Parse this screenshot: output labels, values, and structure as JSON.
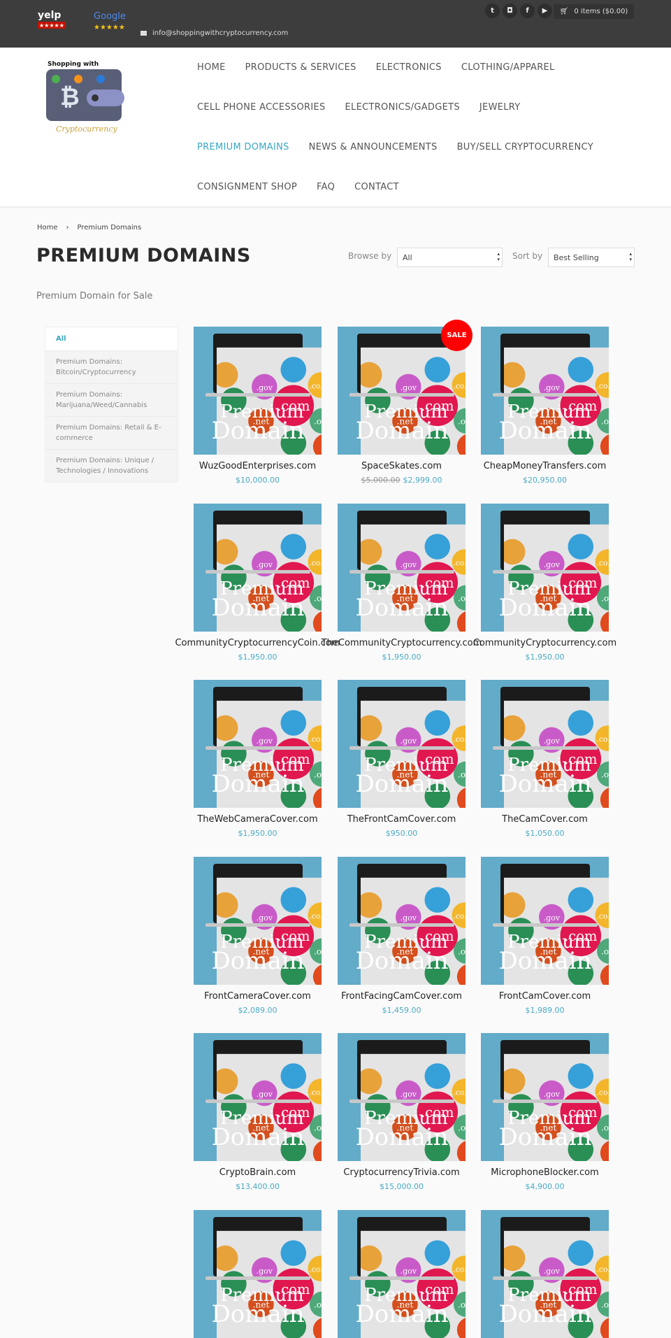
{
  "topbar": {
    "email": "info@shoppingwithcryptocurrency.com",
    "social": [
      "twitter",
      "instagram",
      "facebook",
      "youtube"
    ],
    "cart": "0 items ($0.00)",
    "yelp_logo": "yelp",
    "google_logo": "Google"
  },
  "logo": {
    "top": "Shopping with",
    "bottom": "Cryptocurrency"
  },
  "nav": [
    {
      "label": "HOME"
    },
    {
      "label": "PRODUCTS & SERVICES"
    },
    {
      "label": "ELECTRONICS"
    },
    {
      "label": "CLOTHING/APPAREL"
    },
    {
      "label": "CELL PHONE ACCESSORIES"
    },
    {
      "label": "ELECTRONICS/GADGETS"
    },
    {
      "label": "JEWELRY"
    },
    {
      "label": "PREMIUM DOMAINS",
      "active": true
    },
    {
      "label": "NEWS & ANNOUNCEMENTS"
    },
    {
      "label": "BUY/SELL CRYPTOCURRENCY"
    },
    {
      "label": "CONSIGNMENT SHOP"
    },
    {
      "label": "FAQ"
    },
    {
      "label": "CONTACT"
    }
  ],
  "breadcrumb": {
    "home": "Home",
    "sep": "›",
    "current": "Premium Domains"
  },
  "page": {
    "title": "PREMIUM DOMAINS",
    "subtitle": "Premium Domain for Sale",
    "browse_label": "Browse by",
    "browse_value": "All",
    "sort_label": "Sort by",
    "sort_value": "Best Selling"
  },
  "sidebar": [
    "All",
    "Premium Domains: Bitcoin/Cryptocurrency",
    "Premium Domains: Marijuana/Weed/Cannabis",
    "Premium Domains: Retail & E-commerce",
    "Premium Domains: Unique / Technologies / Innovations"
  ],
  "image_text": {
    "line1": "Premium",
    "line2": "Domain"
  },
  "sale_badge": "SALE",
  "colors": {
    "accent": "#3aa7c3",
    "topbar": "#3d3d3d",
    "image_bg": "#62abc9",
    "sale": "#ff0000"
  },
  "products": [
    {
      "name": "WuzGoodEnterprises.com",
      "price": "$10,000.00"
    },
    {
      "name": "SpaceSkates.com",
      "old_price": "$5,000.00",
      "price": "$2,999.00",
      "sale": true
    },
    {
      "name": "CheapMoneyTransfers.com",
      "price": "$20,950.00"
    },
    {
      "name": "CommunityCryptocurrencyCoin.com",
      "price": "$1,950.00"
    },
    {
      "name": "TheCommunityCryptocurrency.com",
      "price": "$1,950.00"
    },
    {
      "name": "CommunityCryptocurrency.com",
      "price": "$1,950.00"
    },
    {
      "name": "TheWebCameraCover.com",
      "price": "$1,950.00"
    },
    {
      "name": "TheFrontCamCover.com",
      "price": "$950.00"
    },
    {
      "name": "TheCamCover.com",
      "price": "$1,050.00"
    },
    {
      "name": "FrontCameraCover.com",
      "price": "$2,089.00"
    },
    {
      "name": "FrontFacingCamCover.com",
      "price": "$1,459.00"
    },
    {
      "name": "FrontCamCover.com",
      "price": "$1,989.00"
    },
    {
      "name": "CryptoBrain.com",
      "price": "$13,400.00"
    },
    {
      "name": "CryptocurrencyTrivia.com",
      "price": "$15,000.00"
    },
    {
      "name": "MicrophoneBlocker.com",
      "price": "$4,900.00"
    },
    {},
    {},
    {}
  ]
}
